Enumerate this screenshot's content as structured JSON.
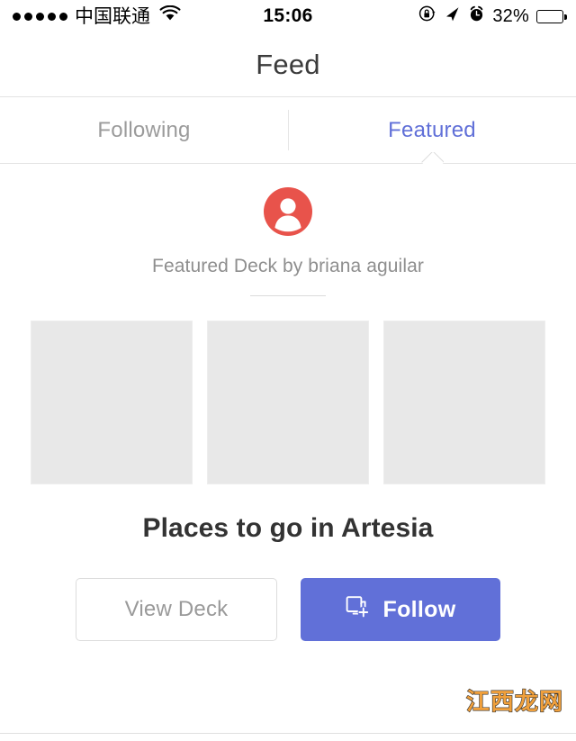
{
  "status_bar": {
    "signal_dots_filled": 5,
    "carrier": "中国联通",
    "wifi_icon": "wifi-icon",
    "time": "15:06",
    "rotation_lock_icon": "rotation-lock-icon",
    "location_icon": "location-arrow-icon",
    "alarm_icon": "alarm-clock-icon",
    "battery_percent": "32%",
    "battery_level": 32
  },
  "navbar": {
    "title": "Feed"
  },
  "tabs": {
    "items": [
      {
        "label": "Following",
        "active": false
      },
      {
        "label": "Featured",
        "active": true
      }
    ],
    "active_color": "#6170d8",
    "inactive_color": "#9b9b9b"
  },
  "feed": {
    "avatar": {
      "icon": "person-avatar-icon",
      "color": "#e8534b"
    },
    "byline": "Featured Deck by briana aguilar",
    "thumbnails": [
      {
        "name": "deck-thumbnail-1",
        "color": "#e8e8e8"
      },
      {
        "name": "deck-thumbnail-2",
        "color": "#e8e8e8"
      },
      {
        "name": "deck-thumbnail-3",
        "color": "#e8e8e8"
      }
    ],
    "deck_title": "Places to go in Artesia",
    "actions": {
      "view_deck_label": "View Deck",
      "follow_label": "Follow",
      "follow_icon": "add-to-collection-icon",
      "follow_color": "#6170d8"
    }
  },
  "watermark": {
    "text": "江西龙网",
    "color": "#f0a03c"
  }
}
